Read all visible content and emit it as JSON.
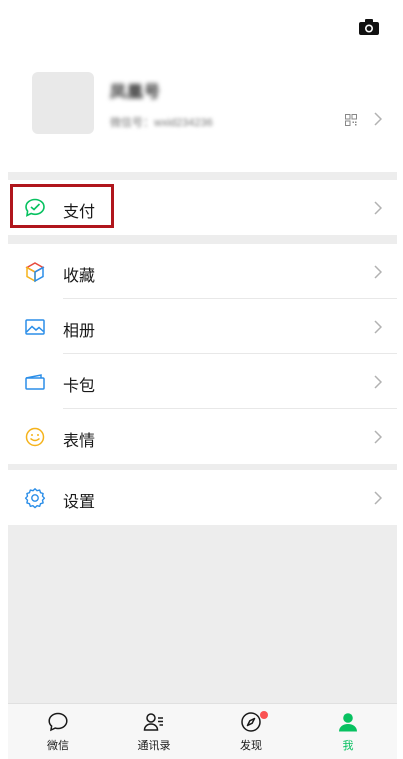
{
  "profile": {
    "nickname": "凤凰号",
    "wechat_id": "微信号：wxid234236"
  },
  "menu": {
    "pay": "支付",
    "favorites": "收藏",
    "album": "相册",
    "cards": "卡包",
    "stickers": "表情",
    "settings": "设置"
  },
  "tabbar": {
    "chats": "微信",
    "contacts": "通讯录",
    "discover": "发现",
    "me": "我"
  },
  "colors": {
    "accent": "#07c160",
    "highlight_box": "#b0161c",
    "badge": "#fa5151"
  }
}
